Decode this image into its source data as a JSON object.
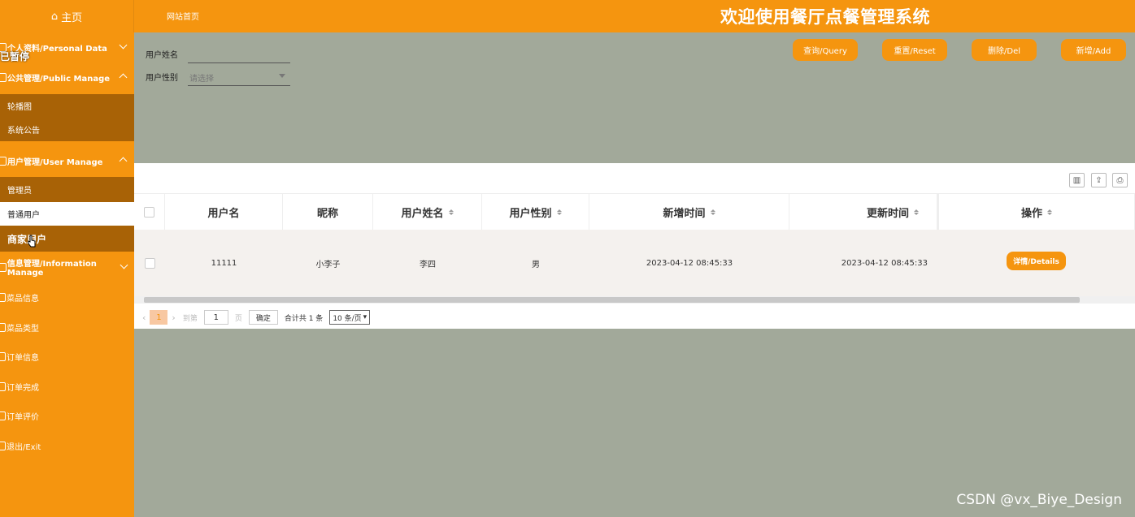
{
  "topbar": {
    "home_label": "主页",
    "site_link": "网站首页",
    "title": "欢迎使用餐厅点餐管理系统"
  },
  "sidebar": {
    "paused_label": "已暂停",
    "groups": [
      {
        "label": "个人资料/Personal Data",
        "expanded": false
      },
      {
        "label": "公共管理/Public Manage",
        "expanded": true,
        "items": [
          "轮播图",
          "系统公告"
        ]
      },
      {
        "label": "用户管理/User Manage",
        "expanded": true,
        "items": [
          "管理员",
          "普通用户",
          "商家用户"
        ],
        "active": "普通用户"
      },
      {
        "label": "信息管理/Information Manage",
        "expanded": false
      }
    ],
    "plain_items": [
      "菜品信息",
      "菜品类型",
      "订单信息",
      "订单完成",
      "订单评价",
      "退出/Exit"
    ]
  },
  "search": {
    "name_label": "用户姓名",
    "name_value": "",
    "gender_label": "用户性别",
    "gender_placeholder": "请选择"
  },
  "buttons": {
    "query": "查询/Query",
    "reset": "重置/Reset",
    "delete": "删除/Del",
    "add": "新增/Add"
  },
  "table": {
    "headers": [
      "用户名",
      "昵称",
      "用户姓名",
      "用户性别",
      "新增时间",
      "更新时间",
      "操作"
    ],
    "rows": [
      {
        "username": "11111",
        "nickname": "小李子",
        "realname": "李四",
        "gender": "男",
        "created": "2023-04-12 08:45:33",
        "updated": "2023-04-12 08:45:33",
        "action": "详情/Details"
      }
    ]
  },
  "pager": {
    "current": "1",
    "goto_label": "到第",
    "goto_value": "1",
    "page_unit": "页",
    "confirm": "确定",
    "total": "合计共 1 条",
    "page_size": "10 条/页"
  },
  "watermark": "CSDN @vx_Biye_Design",
  "colors": {
    "accent": "#f5950f",
    "sidebar_dark": "#a86206",
    "background": "#a2a99a"
  }
}
